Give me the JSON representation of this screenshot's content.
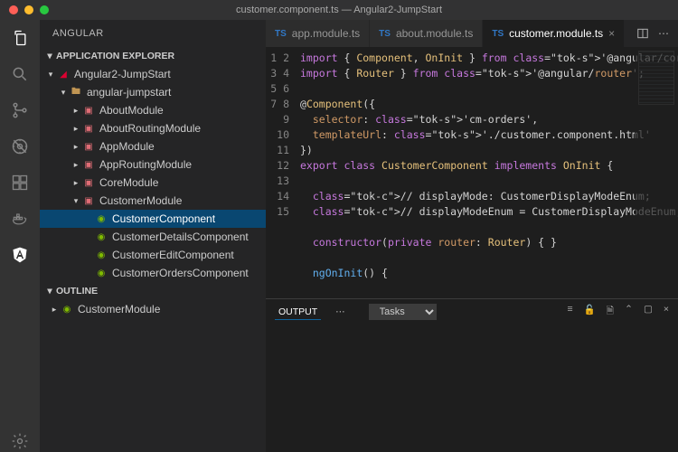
{
  "window_title": "customer.component.ts — Angular2-JumpStart",
  "sidebar": {
    "title": "ANGULAR",
    "sections": {
      "explorer": "APPLICATION EXPLORER",
      "outline": "OUTLINE"
    },
    "tree": {
      "root": "Angular2-JumpStart",
      "project": "angular-jumpstart",
      "modules": [
        "AboutModule",
        "AboutRoutingModule",
        "AppModule",
        "AppRoutingModule",
        "CoreModule",
        "CustomerModule"
      ],
      "customer_children": [
        "CustomerComponent",
        "CustomerDetailsComponent",
        "CustomerEditComponent",
        "CustomerOrdersComponent"
      ]
    },
    "outline_item": "CustomerModule"
  },
  "tabs": {
    "items": [
      {
        "label": "app.module.ts",
        "active": false
      },
      {
        "label": "about.module.ts",
        "active": false
      },
      {
        "label": "customer.module.ts",
        "active": true
      }
    ]
  },
  "code": {
    "lines": 15,
    "raw": [
      "import { Component, OnInit } from '@angular/core';",
      "import { Router } from '@angular/router';",
      "",
      "@Component({",
      "  selector: 'cm-orders',",
      "  templateUrl: './customer.component.html'",
      "})",
      "export class CustomerComponent implements OnInit {",
      "",
      "  // displayMode: CustomerDisplayModeEnum;",
      "  // displayModeEnum = CustomerDisplayModeEnum;",
      "",
      "  constructor(private router: Router) { }",
      "",
      "  ngOnInit() {"
    ]
  },
  "panel": {
    "tab": "OUTPUT",
    "select": "Tasks"
  }
}
